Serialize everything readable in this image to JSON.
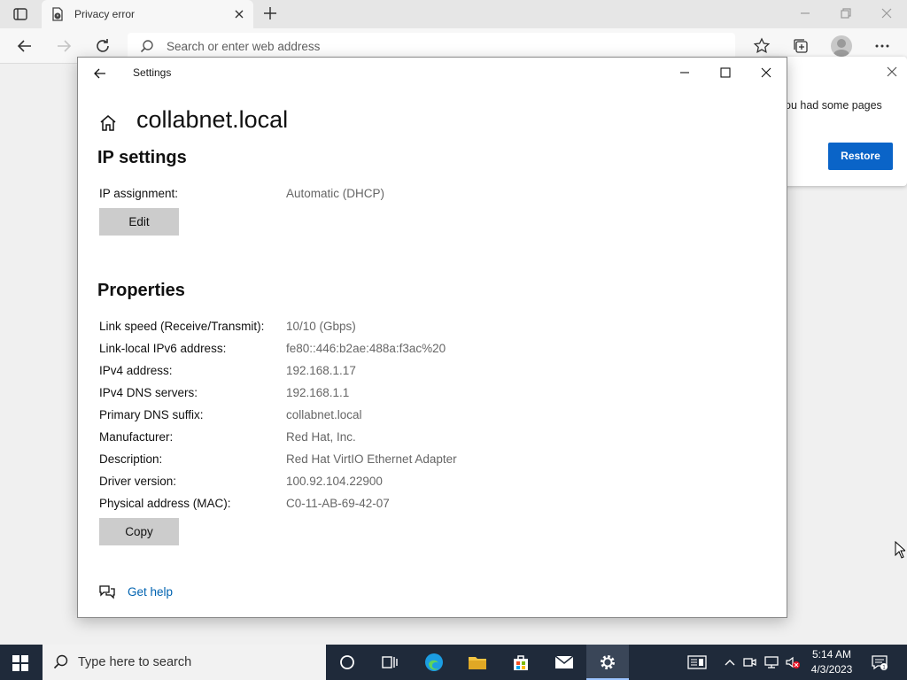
{
  "browser": {
    "tab_title": "Privacy error",
    "address_placeholder": "Search or enter web address",
    "restore_message": "ou had some pages",
    "restore_button": "Restore"
  },
  "settings": {
    "window_title": "Settings",
    "page_title": "collabnet.local",
    "ip_section": {
      "heading": "IP settings",
      "label": "IP assignment:",
      "value": "Automatic (DHCP)",
      "button": "Edit"
    },
    "properties": {
      "heading": "Properties",
      "rows": [
        {
          "label": "Link speed (Receive/Transmit):",
          "value": "10/10 (Gbps)"
        },
        {
          "label": "Link-local IPv6 address:",
          "value": "fe80::446:b2ae:488a:f3ac%20"
        },
        {
          "label": "IPv4 address:",
          "value": "192.168.1.17"
        },
        {
          "label": "IPv4 DNS servers:",
          "value": "192.168.1.1"
        },
        {
          "label": "Primary DNS suffix:",
          "value": "collabnet.local"
        },
        {
          "label": "Manufacturer:",
          "value": "Red Hat, Inc."
        },
        {
          "label": "Description:",
          "value": "Red Hat VirtIO Ethernet Adapter"
        },
        {
          "label": "Driver version:",
          "value": "100.92.104.22900"
        },
        {
          "label": "Physical address (MAC):",
          "value": "C0-11-AB-69-42-07"
        }
      ],
      "button": "Copy"
    },
    "help_link": "Get help"
  },
  "taskbar": {
    "search_placeholder": "Type here to search",
    "time": "5:14 AM",
    "date": "4/3/2023"
  },
  "colors": {
    "accent": "#0a64c8",
    "link": "#0063b1",
    "taskbar": "#1f2a3a"
  }
}
